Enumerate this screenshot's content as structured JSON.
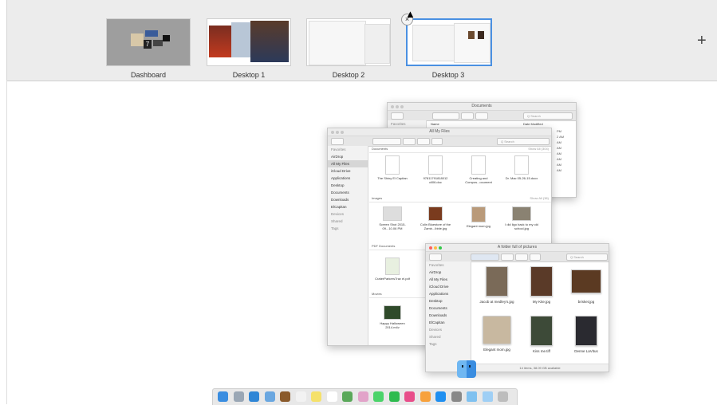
{
  "spaces": [
    {
      "label": "Dashboard"
    },
    {
      "label": "Desktop 1"
    },
    {
      "label": "Desktop 2"
    },
    {
      "label": "Desktop 3"
    }
  ],
  "close_badge": "×",
  "add_space": "+",
  "windows": {
    "documents": {
      "title": "Documents",
      "search": "Q Search",
      "col_name": "Name",
      "col_date": "Date Modified",
      "dates": [
        "PM",
        "2 AM",
        "AM",
        "AM",
        "AM",
        "AM",
        "AM",
        "AM"
      ],
      "sidebar_head": "Favorites"
    },
    "all_my_files": {
      "title": "All My Files",
      "search": "Q Search",
      "sidebar": [
        {
          "label": "Favorites",
          "head": true
        },
        {
          "label": "AirDrop"
        },
        {
          "label": "All My Files",
          "selected": true
        },
        {
          "label": "iCloud Drive"
        },
        {
          "label": "Applications"
        },
        {
          "label": "Desktop"
        },
        {
          "label": "Documents"
        },
        {
          "label": "Downloads"
        },
        {
          "label": "ElCapitan"
        },
        {
          "label": "Devices",
          "head": true
        },
        {
          "label": "Shared",
          "head": true
        },
        {
          "label": "Tags",
          "head": true
        }
      ],
      "sections": {
        "documents": "Documents",
        "images": "Images",
        "pdf": "PDF Documents",
        "movies": "Movies",
        "show_all_docs": "Show All (304)",
        "show_all_images": "Show All (38)"
      },
      "doc_files": [
        "The Shiny El Capitan",
        "97811791818012 cli06.doc",
        "Creating and Compos...ocument",
        "Dr. Mac 05-26-15.docx"
      ],
      "image_files": [
        "Screen Shot 2015-09...10.06 PM",
        "Colin Bluestore of the Zamb...Ibble.jpg",
        "Elegant mom.jpg",
        "I did ligo back to my old school.jpg"
      ],
      "pdf_files": [
        "CraterParkersTrav el.pdf"
      ],
      "movie_files": [
        "Happy Halloween 2014.m4v"
      ]
    },
    "pictures": {
      "title": "A folder full of pictures",
      "search": "Q Search",
      "sidebar": [
        {
          "label": "Favorites",
          "head": true
        },
        {
          "label": "AirDrop"
        },
        {
          "label": "All My Files"
        },
        {
          "label": "iCloud Drive"
        },
        {
          "label": "Applications"
        },
        {
          "label": "Desktop"
        },
        {
          "label": "Documents"
        },
        {
          "label": "Downloads"
        },
        {
          "label": "ElCapitan"
        },
        {
          "label": "Devices",
          "head": true
        },
        {
          "label": "Shared",
          "head": true
        },
        {
          "label": "Tags",
          "head": true
        }
      ],
      "photos": [
        "Jacob at medley's.jpg",
        "My Kite.jpg",
        "brisket.jpg",
        "Elegant mom.jpg",
        "Kiss me.tiff",
        "Denne LaVitus"
      ],
      "status": "14 items, 38.09 GB available"
    }
  },
  "dock": {
    "icons": [
      "finder-icon",
      "launchpad-icon",
      "safari-icon",
      "mail-icon",
      "contacts-icon",
      "calendar-icon",
      "notes-icon",
      "reminders-icon",
      "maps-icon",
      "photos-icon",
      "messages-icon",
      "facetime-icon",
      "itunes-icon",
      "ibooks-icon",
      "app-store-icon",
      "system-preferences-icon",
      "folder-icon",
      "downloads-icon",
      "trash-icon"
    ],
    "colors": [
      "#3a8de0",
      "#9aa7b5",
      "#2f86d6",
      "#6aa7e0",
      "#8a5a2b",
      "#f2f2f2",
      "#f5e16b",
      "#ffffff",
      "#5aa85a",
      "#e2a3c9",
      "#4bd36a",
      "#2ebb4f",
      "#e84e8a",
      "#f7a13c",
      "#1f8ff0",
      "#888888",
      "#7fc1f0",
      "#9fcff5",
      "#bdbdbd"
    ]
  }
}
